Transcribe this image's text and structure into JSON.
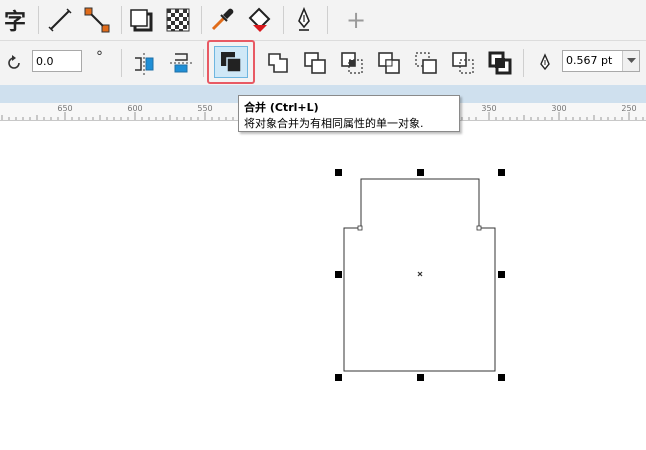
{
  "toolbar_top": {
    "icons": [
      "text-tool-icon",
      "dimension-line-icon",
      "connector-line-icon",
      "drop-shadow-icon",
      "transparency-icon",
      "eyedropper-icon",
      "smart-fill-icon",
      "pen-outline-icon",
      "add-icon"
    ],
    "text_tool_glyph": "字",
    "add_glyph": "+"
  },
  "toolbar_property": {
    "rotation_value": "0.0",
    "degree_symbol": "°",
    "outline_width_value": "0.567 pt"
  },
  "ruler": {
    "labels": [
      "650",
      "600",
      "550",
      "350",
      "300",
      "250"
    ]
  },
  "tooltip": {
    "title": "合并 (Ctrl+L)",
    "description": "将对象合并为有相同属性的单一对象."
  },
  "colors": {
    "toolbar_bg": "#f3f3f3",
    "band_bg": "#cfe0ee",
    "highlight_border": "#e85a64",
    "highlight_fill": "#cfe8f7",
    "accent_blue": "#1f8fd6",
    "accent_orange": "#e06b1a",
    "accent_red": "#d9191e"
  }
}
